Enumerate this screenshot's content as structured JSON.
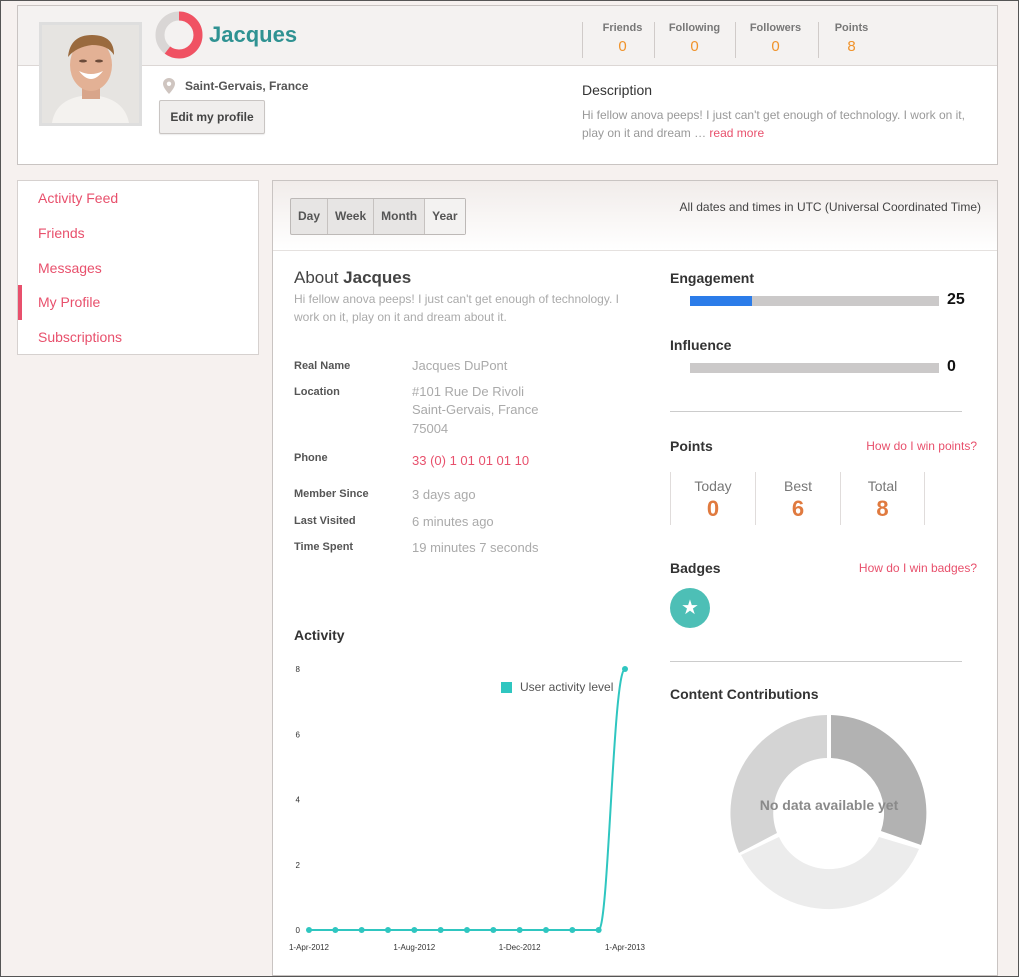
{
  "profile": {
    "name": "Jacques",
    "location": "Saint-Gervais, France",
    "edit_label": "Edit my profile",
    "description_title": "Description",
    "description_text": "Hi fellow anova peeps! I just can't get enough of technology. I work on it, play on it and dream …",
    "read_more": "read more",
    "stats": [
      {
        "label": "Friends",
        "value": "0"
      },
      {
        "label": "Following",
        "value": "0"
      },
      {
        "label": "Followers",
        "value": "0"
      },
      {
        "label": "Points",
        "value": "8"
      }
    ]
  },
  "sidebar": {
    "items": [
      {
        "label": "Activity Feed"
      },
      {
        "label": "Friends"
      },
      {
        "label": "Messages"
      },
      {
        "label": "My Profile"
      },
      {
        "label": "Subscriptions"
      }
    ],
    "active_index": 3
  },
  "range_tabs": {
    "items": [
      "Day",
      "Week",
      "Month",
      "Year"
    ],
    "active": "Year"
  },
  "timezone_note": "All dates and times in UTC (Universal Coordinated Time)",
  "about": {
    "title_prefix": "About",
    "title_name": "Jacques",
    "text": "Hi fellow anova peeps! I just can't get enough of technology. I work on it, play on it and dream about it."
  },
  "details": {
    "real_name_label": "Real Name",
    "real_name": "Jacques DuPont",
    "location_label": "Location",
    "address_line1": "#101 Rue De Rivoli",
    "address_line2": "Saint-Gervais, France",
    "address_line3": "75004",
    "phone_label": "Phone",
    "phone": "33 (0) 1 01 01 01 10",
    "member_since_label": "Member Since",
    "member_since": "3 days ago",
    "last_visited_label": "Last Visited",
    "last_visited": "6 minutes ago",
    "time_spent_label": "Time Spent",
    "time_spent": "19 minutes 7 seconds"
  },
  "engagement": {
    "title": "Engagement",
    "value": 25,
    "fill_fraction": 0.25,
    "value_text": "25"
  },
  "influence": {
    "title": "Influence",
    "value": 0,
    "fill_fraction": 0,
    "value_text": "0"
  },
  "points": {
    "title": "Points",
    "help": "How do I win points?",
    "boxes": [
      {
        "label": "Today",
        "value": "0"
      },
      {
        "label": "Best",
        "value": "6"
      },
      {
        "label": "Total",
        "value": "8"
      }
    ]
  },
  "badges": {
    "title": "Badges",
    "help": "How do I win badges?",
    "icon": "star-icon"
  },
  "content": {
    "title": "Content Contributions",
    "empty_text": "No data available yet"
  },
  "activity": {
    "title": "Activity"
  },
  "colors": {
    "accent": "#e8506c",
    "teal": "#2fc6c0",
    "orange": "#f0932b",
    "blue": "#2b7ce9"
  },
  "chart_data": {
    "type": "line",
    "title": "Activity",
    "series": [
      {
        "name": "User activity level",
        "x": [
          "2012-04-01",
          "2012-05-01",
          "2012-06-01",
          "2012-07-01",
          "2012-08-01",
          "2012-09-01",
          "2012-10-01",
          "2012-11-01",
          "2012-12-01",
          "2013-01-01",
          "2013-02-01",
          "2013-03-01",
          "2013-04-01"
        ],
        "values": [
          0,
          0,
          0,
          0,
          0,
          0,
          0,
          0,
          0,
          0,
          0,
          0,
          8
        ]
      }
    ],
    "x_ticks": [
      "1-Apr-2012",
      "1-Aug-2012",
      "1-Dec-2012",
      "1-Apr-2013"
    ],
    "y_ticks": [
      "0",
      "2",
      "4",
      "6",
      "8"
    ],
    "ylim": [
      0,
      8
    ],
    "legend": "top-right"
  }
}
